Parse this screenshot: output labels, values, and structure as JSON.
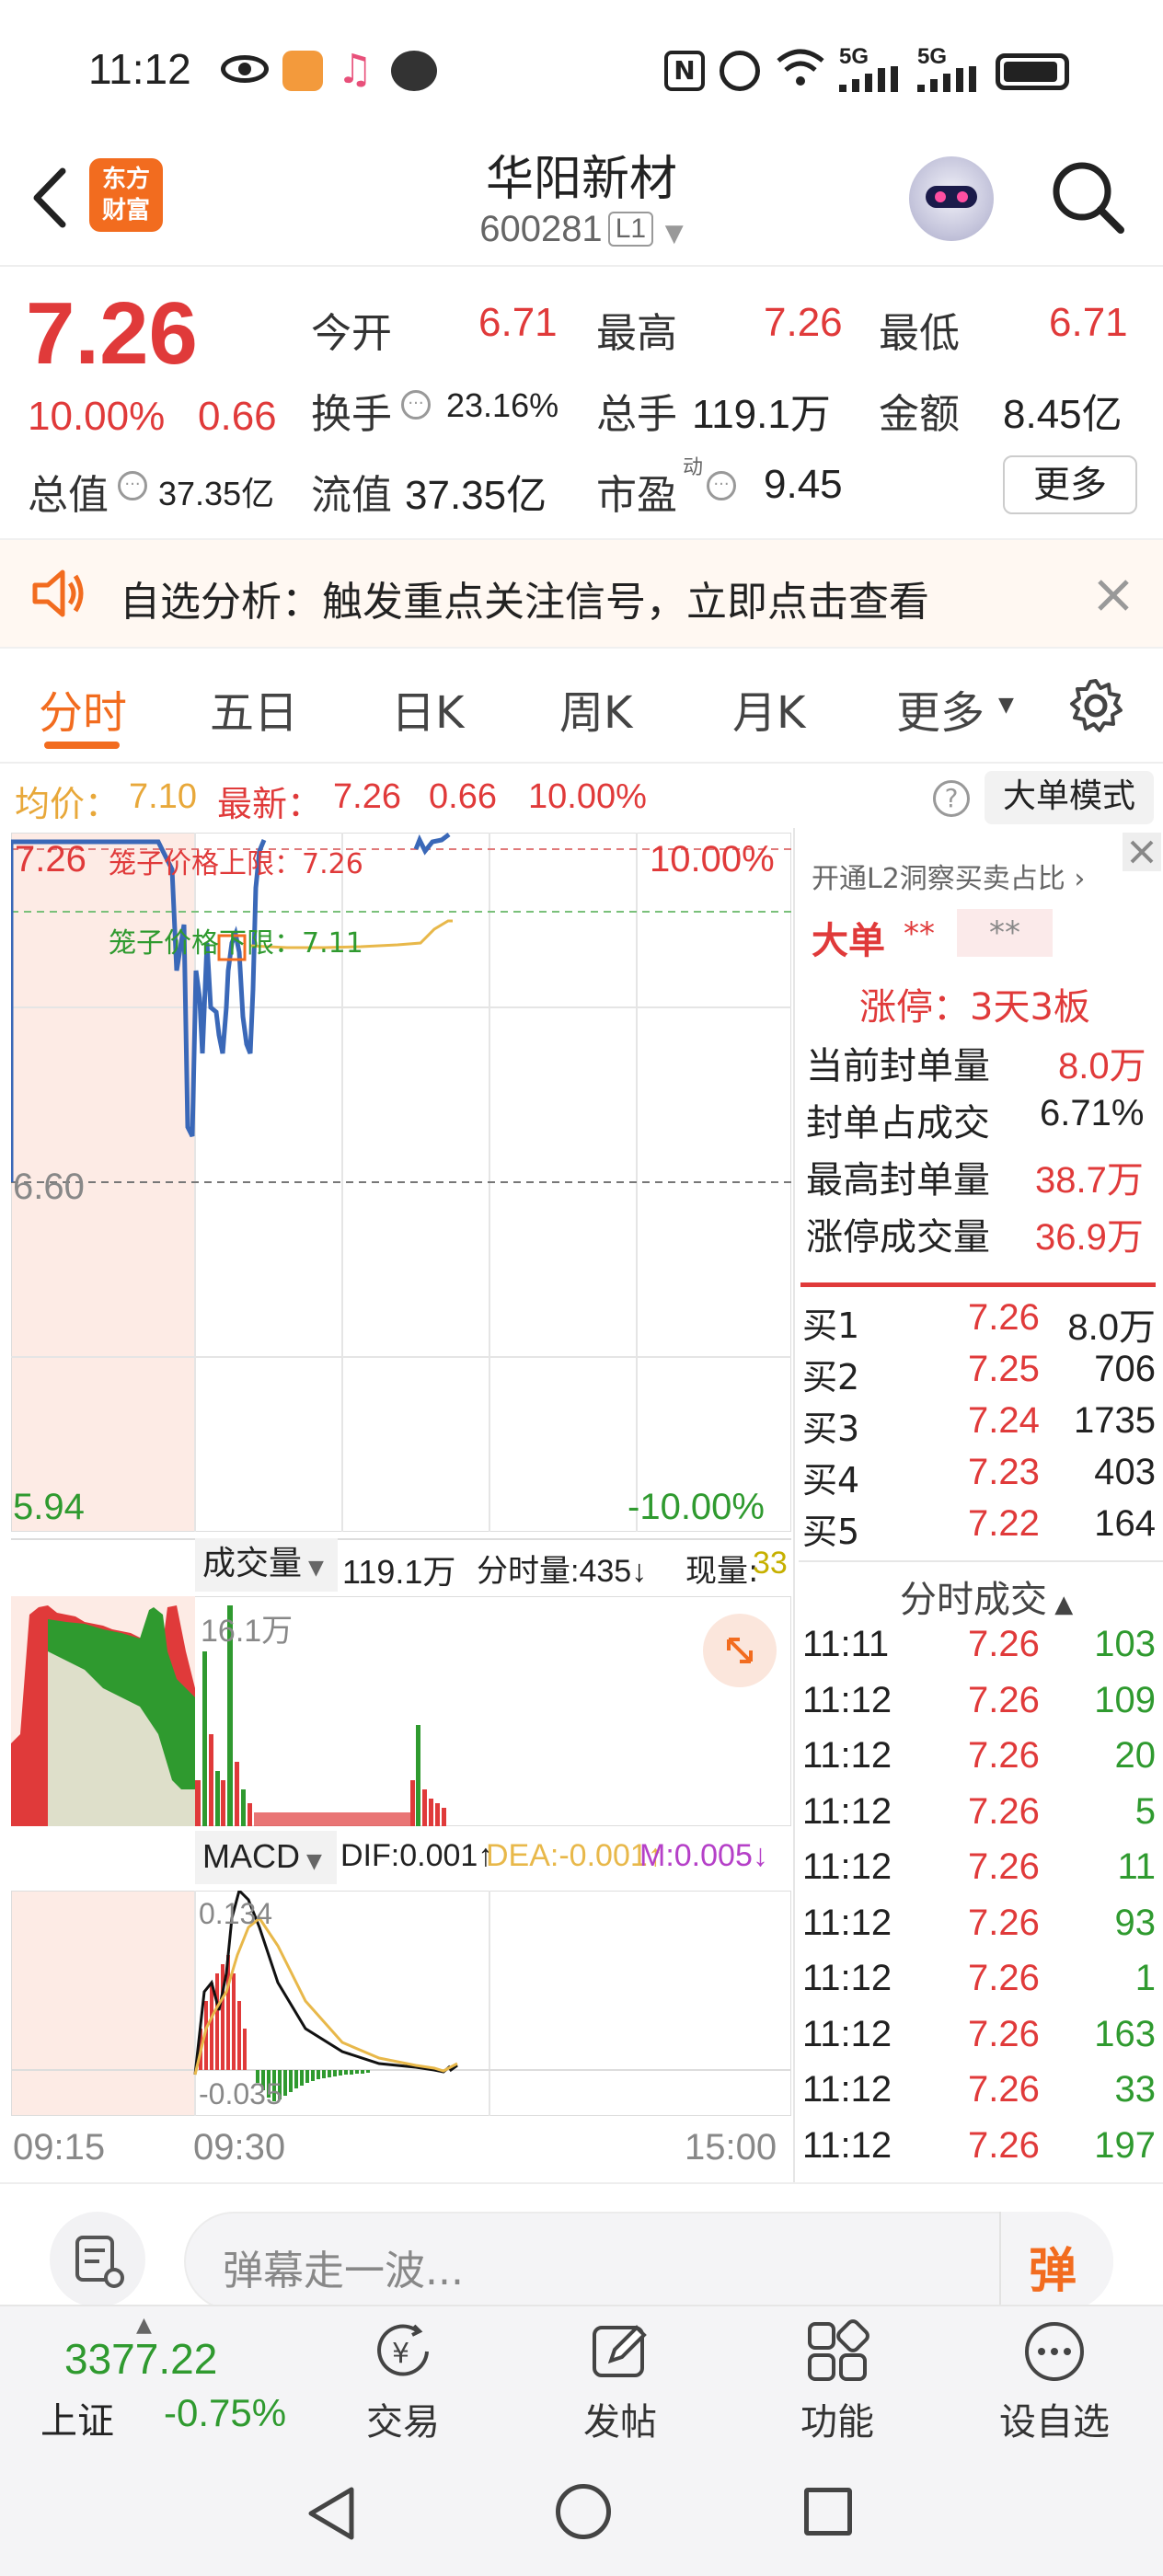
{
  "status_bar": {
    "time": "11:12",
    "net1": "5G",
    "net2": "5G"
  },
  "header": {
    "logo_line1": "东方",
    "logo_line2": "财富",
    "stock_name": "华阳新材",
    "stock_code": "600281",
    "level_badge": "L1"
  },
  "quote": {
    "price": "7.26",
    "change_pct": "10.00%",
    "change_amt": "0.66",
    "open_label": "今开",
    "open": "6.71",
    "high_label": "最高",
    "high": "7.26",
    "low_label": "最低",
    "low": "6.71",
    "turnover_label": "换手",
    "turnover": "23.16%",
    "volume_label": "总手",
    "volume": "119.1万",
    "amount_label": "金额",
    "amount": "8.45亿",
    "total_mv_label": "总值",
    "total_mv": "37.35亿",
    "float_mv_label": "流值",
    "float_mv": "37.35亿",
    "pe_label": "市盈",
    "pe_super": "动",
    "pe": "9.45",
    "more_button": "更多"
  },
  "alert": {
    "text": "自选分析：触发重点关注信号，立即点击查看"
  },
  "tabs": [
    "分时",
    "五日",
    "日K",
    "周K",
    "月K",
    "更多"
  ],
  "chart_header": {
    "avg_label": "均价：",
    "avg": "7.10",
    "latest_label": "最新：",
    "latest": "7.26",
    "latest_chg": "0.66",
    "latest_pct": "10.00%",
    "big_order_mode": "大单模式"
  },
  "price_chart": {
    "y_top": "7.26",
    "y_mid": "6.60",
    "y_bot": "5.94",
    "pct_top": "10.00%",
    "pct_bot": "-10.00%",
    "cage_upper": "笼子价格上限：7.26",
    "cage_lower": "笼子价格下限：7.11"
  },
  "volume_panel": {
    "selector": "成交量",
    "total": "119.1万",
    "tick_vol": "分时量:435↓",
    "current_label": "现量:",
    "current": "33",
    "max_label": "16.1万"
  },
  "macd_panel": {
    "selector": "MACD",
    "dif": "DIF:0.001↑",
    "dea": "DEA:-0.001↑",
    "m": "M:0.005↓",
    "top_label": "0.134",
    "bot_label": "-0.035"
  },
  "time_axis": [
    "09:15",
    "09:30",
    "15:00"
  ],
  "right_panel": {
    "l2_link": "开通L2洞察买卖占比 ›",
    "big_order_label": "大单",
    "big_order_val": "**",
    "big_order_val2": "**",
    "limit_up": "涨停：3天3板",
    "rows": [
      {
        "label": "当前封单量",
        "value": "8.0万"
      },
      {
        "label": "封单占成交",
        "value": "6.71%"
      },
      {
        "label": "最高封单量",
        "value": "38.7万"
      },
      {
        "label": "涨停成交量",
        "value": "36.9万"
      }
    ],
    "bids": [
      {
        "label": "买1",
        "price": "7.26",
        "vol": "8.0万"
      },
      {
        "label": "买2",
        "price": "7.25",
        "vol": "706"
      },
      {
        "label": "买3",
        "price": "7.24",
        "vol": "1735"
      },
      {
        "label": "买4",
        "price": "7.23",
        "vol": "403"
      },
      {
        "label": "买5",
        "price": "7.22",
        "vol": "164"
      }
    ],
    "trades_title": "分时成交",
    "trades": [
      {
        "time": "11:11",
        "price": "7.26",
        "vol": "103",
        "side": "buy"
      },
      {
        "time": "11:12",
        "price": "7.26",
        "vol": "109",
        "side": "buy"
      },
      {
        "time": "11:12",
        "price": "7.26",
        "vol": "20",
        "side": "buy"
      },
      {
        "time": "11:12",
        "price": "7.26",
        "vol": "5",
        "side": "buy"
      },
      {
        "time": "11:12",
        "price": "7.26",
        "vol": "11",
        "side": "buy"
      },
      {
        "time": "11:12",
        "price": "7.26",
        "vol": "93",
        "side": "buy"
      },
      {
        "time": "11:12",
        "price": "7.26",
        "vol": "1",
        "side": "buy"
      },
      {
        "time": "11:12",
        "price": "7.26",
        "vol": "163",
        "side": "buy"
      },
      {
        "time": "11:12",
        "price": "7.26",
        "vol": "33",
        "side": "buy"
      },
      {
        "time": "11:12",
        "price": "7.26",
        "vol": "197",
        "side": "buy"
      }
    ]
  },
  "comment_bar": {
    "placeholder": "弹幕走一波...",
    "danmu_icon_text": "弹"
  },
  "bottom_nav": {
    "index_value": "3377.22",
    "index_name": "上证",
    "index_change": "-0.75%",
    "items": [
      "交易",
      "发帖",
      "功能",
      "设自选"
    ]
  },
  "colors": {
    "up": "#e03a3a",
    "down": "#2f9a2f",
    "line": "#3a68b8",
    "avg": "#e8b84a",
    "brand": "#f26c1f"
  }
}
